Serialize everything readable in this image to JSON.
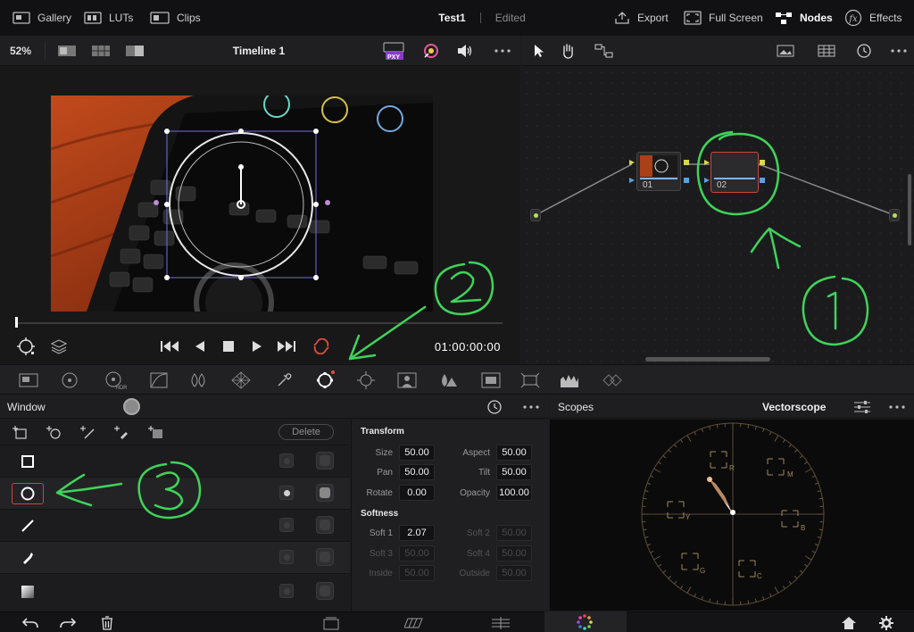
{
  "topbar": {
    "gallery": "Gallery",
    "luts": "LUTs",
    "clips": "Clips",
    "project_title": "Test1",
    "project_state": "Edited",
    "export": "Export",
    "full_screen": "Full Screen",
    "nodes": "Nodes",
    "effects": "Effects"
  },
  "viewer_toolbar": {
    "zoom": "52%",
    "timeline_name": "Timeline 1",
    "proxy_badge": "PXY"
  },
  "transport": {
    "timecode": "01:00:00:00"
  },
  "nodes": {
    "node1_label": "01",
    "node2_label": "02"
  },
  "window_panel": {
    "title": "Window",
    "delete_label": "Delete"
  },
  "transform": {
    "section_title": "Transform",
    "size_label": "Size",
    "size_value": "50.00",
    "aspect_label": "Aspect",
    "aspect_value": "50.00",
    "pan_label": "Pan",
    "pan_value": "50.00",
    "tilt_label": "Tilt",
    "tilt_value": "50.00",
    "rotate_label": "Rotate",
    "rotate_value": "0.00",
    "opacity_label": "Opacity",
    "opacity_value": "100.00"
  },
  "softness": {
    "section_title": "Softness",
    "soft1_label": "Soft 1",
    "soft1_value": "2.07",
    "soft2_label": "Soft 2",
    "soft2_value": "50.00",
    "soft3_label": "Soft 3",
    "soft3_value": "50.00",
    "soft4_label": "Soft 4",
    "soft4_value": "50.00",
    "inside_label": "Inside",
    "inside_value": "50.00",
    "outside_label": "Outside",
    "outside_value": "50.00"
  },
  "scopes": {
    "title": "Scopes",
    "mode": "Vectorscope",
    "target_r": "R",
    "target_mg": "M",
    "target_b": "B",
    "target_cy": "C",
    "target_g": "G",
    "target_yl": "Y"
  },
  "colors": {
    "accent_red": "#d0443a",
    "annotation_green": "#3fd35a",
    "node_link_blue": "#7fb4ff"
  }
}
